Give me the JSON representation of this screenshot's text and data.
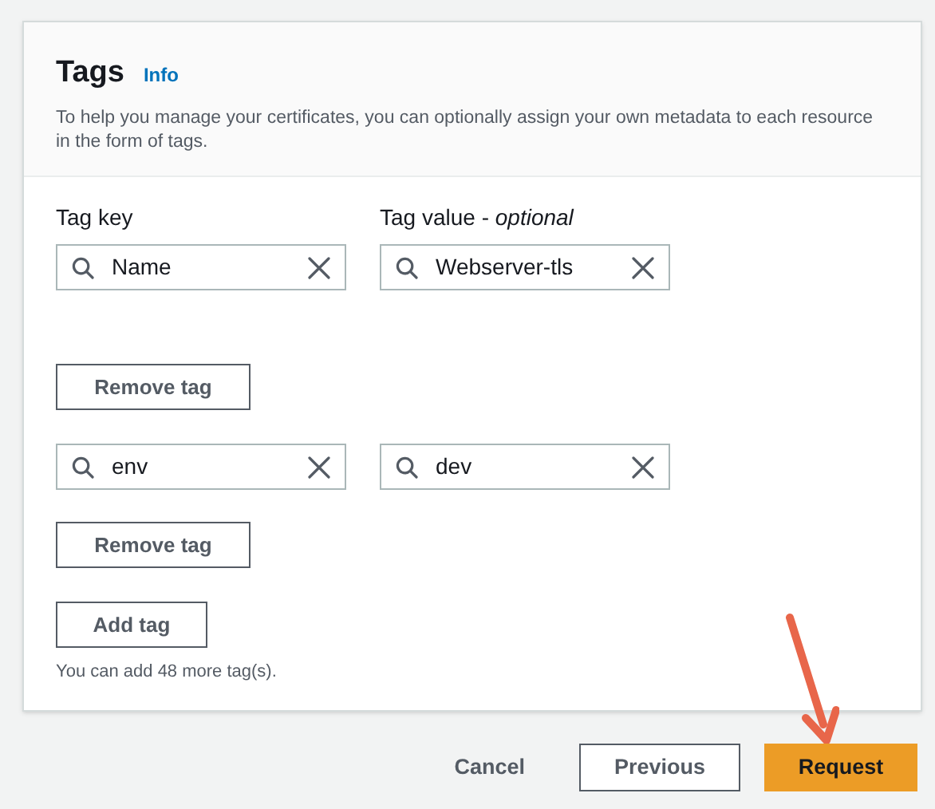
{
  "panel": {
    "title": "Tags",
    "info_link": "Info",
    "description": "To help you manage your certificates, you can optionally assign your own metadata to each resource in the form of tags."
  },
  "columns": {
    "key_label": "Tag key",
    "value_label": "Tag value - *optional*"
  },
  "tags": [
    {
      "key": "Name",
      "value": "Webserver-tls",
      "remove_label": "Remove tag"
    },
    {
      "key": "env",
      "value": "dev",
      "remove_label": "Remove tag"
    }
  ],
  "add_button": "Add tag",
  "limit_hint": "You can add 48 more tag(s).",
  "footer": {
    "cancel": "Cancel",
    "previous": "Previous",
    "primary": "Request"
  },
  "annotation": {
    "kind": "arrow"
  }
}
